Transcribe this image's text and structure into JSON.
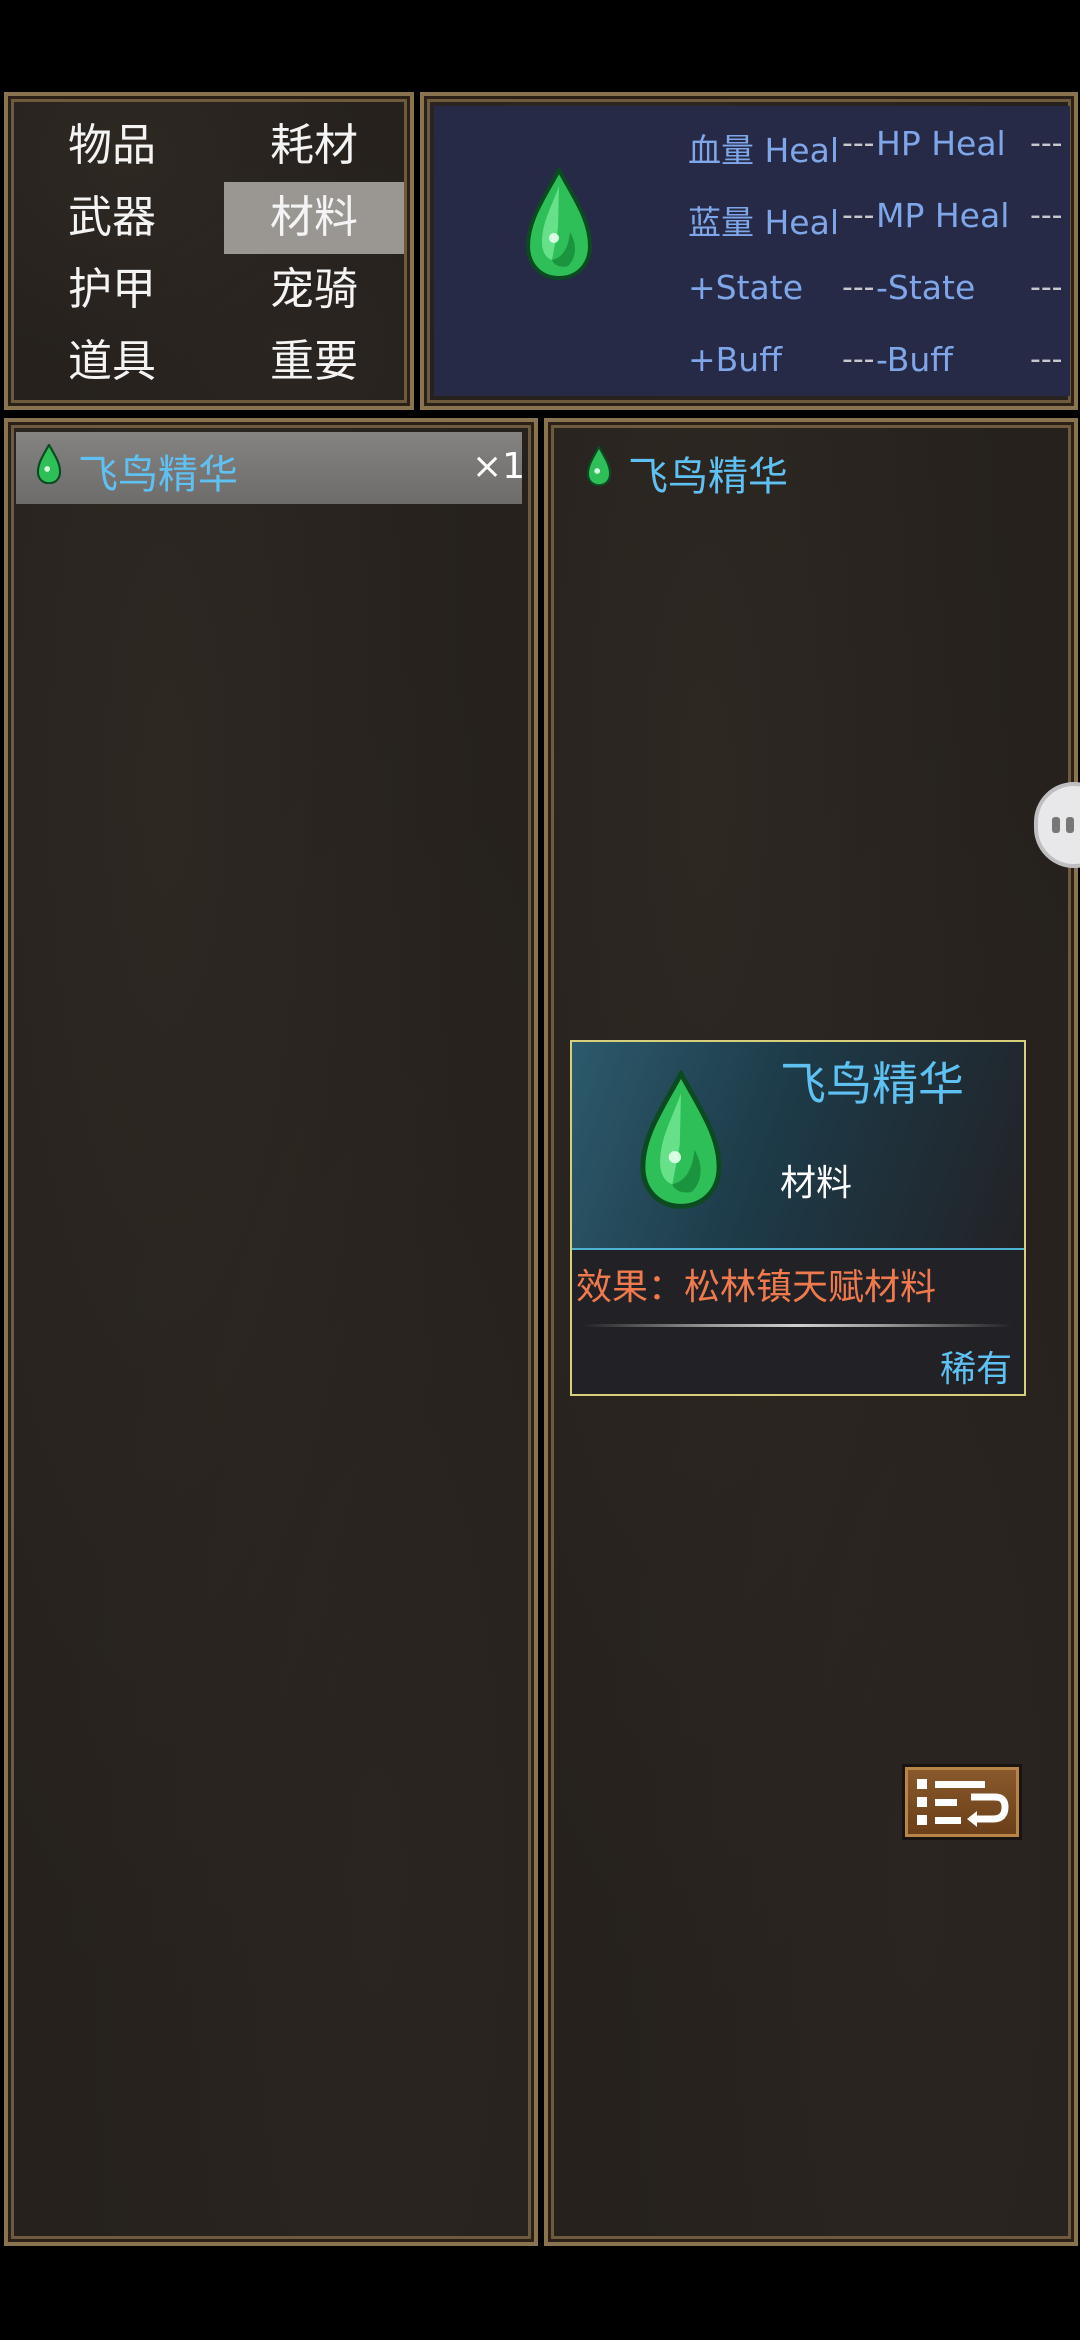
{
  "categories": [
    "物品",
    "耗材",
    "武器",
    "材料",
    "护甲",
    "宠骑",
    "道具",
    "重要"
  ],
  "selected_category": "材料",
  "stats": {
    "hp_heal_label": "血量 Heal",
    "hp_heal_value": "---",
    "hp_heal_alt_label": "HP Heal",
    "hp_heal_alt_value": "---",
    "mp_heal_label": "蓝量 Heal",
    "mp_heal_value": "---",
    "mp_heal_alt_label": "MP Heal",
    "mp_heal_alt_value": "---",
    "add_state_label": "+State",
    "add_state_value": "---",
    "remove_state_label": "-State",
    "remove_state_value": "---",
    "add_buff_label": "+Buff",
    "add_buff_value": "---",
    "remove_buff_label": "-Buff",
    "remove_buff_value": "---"
  },
  "item_list": [
    {
      "name": "飞鸟精华",
      "count": "×1",
      "icon": "green-gem-icon"
    }
  ],
  "detail": {
    "name": "飞鸟精华",
    "card": {
      "title": "飞鸟精华",
      "type": "材料",
      "effect": "效果：松林镇天赋材料",
      "rarity": "稀有"
    }
  },
  "colors": {
    "accent_blue": "#5fc0f2",
    "effect_orange": "#f07a4e",
    "stat_blue": "#7fa6e8",
    "panel_border": "#8a7450"
  }
}
